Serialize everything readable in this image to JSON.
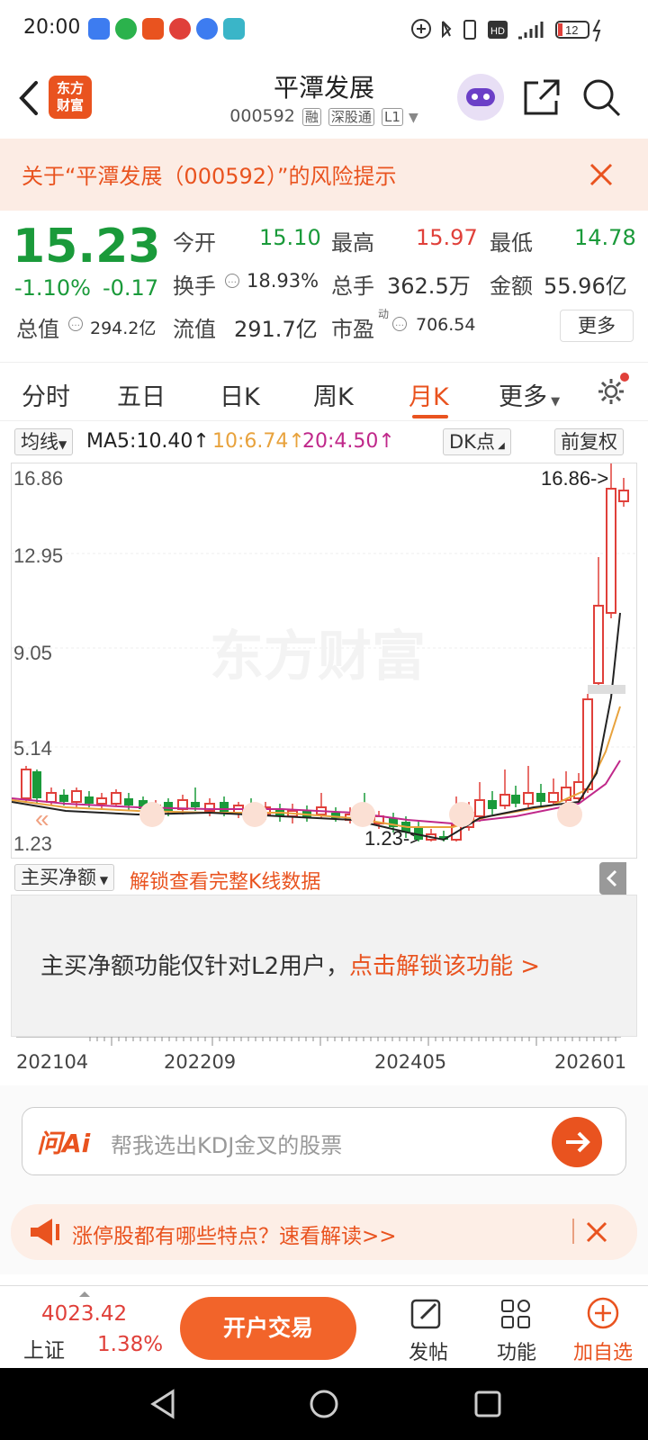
{
  "status_bar": {
    "time": "20:00",
    "battery": "12"
  },
  "header": {
    "logo_text_1": "东方",
    "logo_text_2": "财富",
    "title": "平潭发展",
    "code": "000592",
    "tag_rong": "融",
    "tag_sgt": "深股通",
    "tag_l1": "L1"
  },
  "banner": {
    "text": "关于“平潭发展（000592）”的风险提示"
  },
  "quote": {
    "price": "15.23",
    "change_pct": "-1.10%",
    "change": "-0.17",
    "open_label": "今开",
    "open": "15.10",
    "high_label": "最高",
    "high": "15.97",
    "low_label": "最低",
    "low": "14.78",
    "turnover_label": "换手",
    "turnover": "18.93%",
    "volume_label": "总手",
    "volume": "362.5万",
    "amount_label": "金额",
    "amount": "55.96亿",
    "mcap_label": "总值",
    "mcap": "294.2亿",
    "float_label": "流值",
    "float": "291.7亿",
    "pe_label": "市盈",
    "pe_sup": "动",
    "pe": "706.54",
    "more": "更多"
  },
  "tabs": [
    {
      "label": "分时"
    },
    {
      "label": "五日"
    },
    {
      "label": "日K"
    },
    {
      "label": "周K"
    },
    {
      "label": "月K"
    },
    {
      "label": "更多"
    }
  ],
  "chart_bar": {
    "indicator": "均线",
    "ma5": "MA5:10.40↑",
    "ma10": "10:6.74↑",
    "ma20": "20:4.50↑",
    "dk": "DK点",
    "adjust": "前复权"
  },
  "chart_data": {
    "type": "candlestick",
    "y_ticks": [
      "16.86",
      "12.95",
      "9.05",
      "5.14",
      "1.23"
    ],
    "ylim": [
      1.23,
      16.86
    ],
    "max_label": "16.86->",
    "min_label": "1.23->",
    "watermark": "东方财富",
    "x_ticks": [
      "202104",
      "202209",
      "202405",
      "202601"
    ],
    "colors": {
      "up": "#e0403a",
      "down": "#1a9a3a",
      "ma5": "#222222",
      "ma10": "#e8a23c",
      "ma20": "#c0288a"
    }
  },
  "mainbuy": {
    "select": "主买净额",
    "unlock": "解锁查看完整K线数据"
  },
  "panel": {
    "text": "主买净额功能仅针对L2用户，",
    "link": "点击解锁该功能 >"
  },
  "ai": {
    "brand": "问Ai",
    "placeholder": "帮我选出KDJ金叉的股票"
  },
  "notice": {
    "text": "涨停股都有哪些特点？速看解读>>"
  },
  "bottom": {
    "index_value": "4023.42",
    "index_name": "上证",
    "index_pct": "1.38%",
    "trade_btn": "开户交易",
    "post": "发帖",
    "func": "功能",
    "add": "加自选"
  }
}
